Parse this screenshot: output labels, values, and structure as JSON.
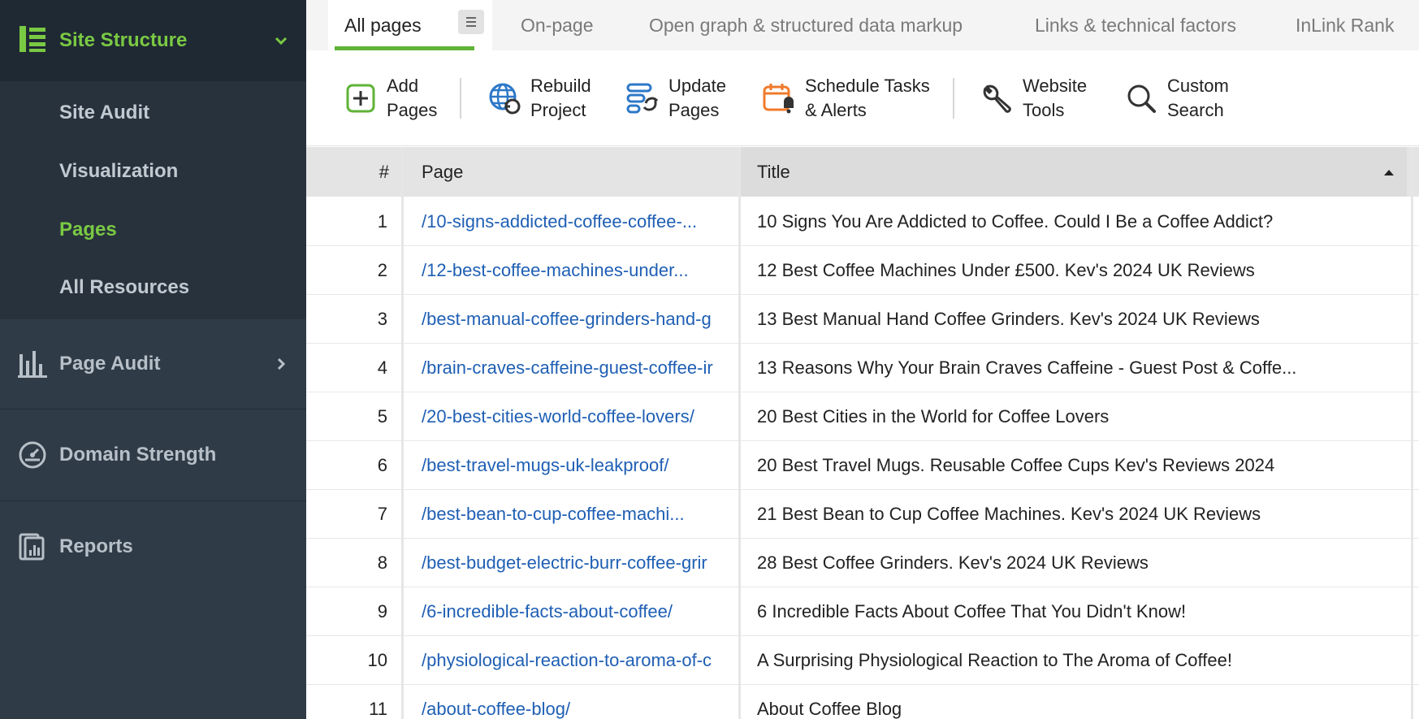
{
  "sidebar": {
    "site_structure": {
      "label": "Site Structure",
      "icon": "site-structure-icon"
    },
    "sub_items": [
      {
        "label": "Site Audit"
      },
      {
        "label": "Visualization"
      },
      {
        "label": "Pages",
        "active": true
      },
      {
        "label": "All Resources"
      }
    ],
    "page_audit": {
      "label": "Page Audit",
      "icon": "page-audit-icon"
    },
    "domain_strength": {
      "label": "Domain Strength",
      "icon": "gauge-icon"
    },
    "reports": {
      "label": "Reports",
      "icon": "reports-icon"
    }
  },
  "tabs": [
    {
      "label": "All pages",
      "active": true
    },
    {
      "label": "On-page"
    },
    {
      "label": "Open graph & structured data markup"
    },
    {
      "label": "Links & technical factors"
    },
    {
      "label": "InLink Rank"
    }
  ],
  "toolbar": {
    "add_pages": "Add\nPages",
    "rebuild_project": "Rebuild\nProject",
    "update_pages": "Update\nPages",
    "schedule": "Schedule Tasks\n& Alerts",
    "website_tools": "Website\nTools",
    "custom_search": "Custom\nSearch"
  },
  "table": {
    "headers": {
      "num": "#",
      "page": "Page",
      "title": "Title"
    },
    "sort": "ascending",
    "rows": [
      {
        "num": "1",
        "page": "/10-signs-addicted-coffee-coffee-...",
        "title": "10 Signs You Are Addicted to Coffee. Could I Be a Coffee Addict?"
      },
      {
        "num": "2",
        "page": "/12-best-coffee-machines-under...",
        "title": "12 Best Coffee Machines Under £500. Kev's 2024 UK Reviews"
      },
      {
        "num": "3",
        "page": "/best-manual-coffee-grinders-hand-g",
        "title": "13 Best Manual Hand Coffee Grinders. Kev's 2024 UK Reviews"
      },
      {
        "num": "4",
        "page": "/brain-craves-caffeine-guest-coffee-ir",
        "title": "13 Reasons Why Your Brain Craves Caffeine - Guest Post & Coffe..."
      },
      {
        "num": "5",
        "page": "/20-best-cities-world-coffee-lovers/",
        "title": "20 Best Cities in the World for Coffee Lovers"
      },
      {
        "num": "6",
        "page": "/best-travel-mugs-uk-leakproof/",
        "title": "20 Best Travel Mugs. Reusable Coffee Cups Kev's Reviews 2024"
      },
      {
        "num": "7",
        "page": "/best-bean-to-cup-coffee-machi...",
        "title": "21 Best Bean to Cup Coffee Machines. Kev's 2024 UK Reviews"
      },
      {
        "num": "8",
        "page": "/best-budget-electric-burr-coffee-grir",
        "title": "28 Best Coffee Grinders. Kev's 2024 UK Reviews"
      },
      {
        "num": "9",
        "page": "/6-incredible-facts-about-coffee/",
        "title": "6 Incredible Facts About Coffee That You Didn't Know!"
      },
      {
        "num": "10",
        "page": "/physiological-reaction-to-aroma-of-c",
        "title": "A Surprising Physiological Reaction to The Aroma of Coffee!"
      },
      {
        "num": "11",
        "page": "/about-coffee-blog/",
        "title": "About Coffee Blog"
      }
    ]
  },
  "colors": {
    "accent_green": "#7ac943",
    "link_blue": "#1f5fb4",
    "sidebar_bg": "#2f3b47"
  }
}
